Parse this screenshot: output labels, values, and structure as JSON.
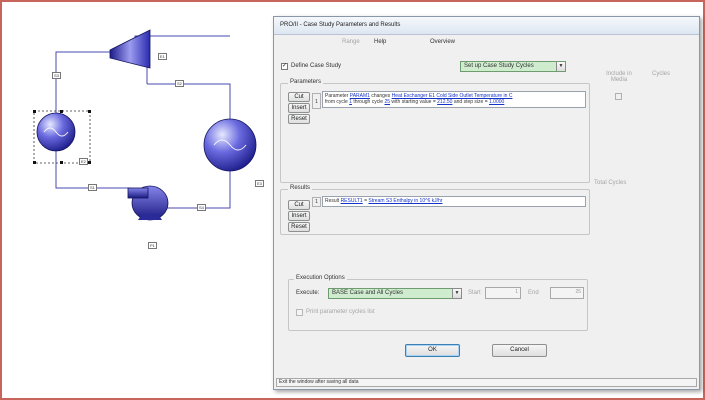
{
  "flowsheet": {
    "stream_labels": [
      "S3",
      "S2",
      "S1",
      "S4",
      "S5"
    ],
    "unit_labels": [
      "E1",
      "E2",
      "P1",
      "E3"
    ]
  },
  "dialog": {
    "title": "PRO/II - Case Study Parameters and Results",
    "menu": {
      "range": "Range",
      "help": "Help",
      "overview": "Overview"
    },
    "define_case_study": "Define Case Study",
    "setup_cycles_select": "Set up Case Study Cycles",
    "parameters_title": "Parameters",
    "include_in_media": "Include in Media",
    "cycles_col": "Cycles",
    "total_cycles": "Total Cycles",
    "buttons": {
      "cut": "Cut",
      "insert": "Insert",
      "reset": "Reset"
    },
    "parameter_row": {
      "index": "1",
      "text_prefix": "Parameter ",
      "param_name": "PARAM1",
      "text_changes": " changes ",
      "param_target": "Heat Exchanger E1 Cold Side Outlet Temperature in C",
      "text_from_cycle": "from cycle ",
      "from_cycle": "1",
      "text_through": " through cycle ",
      "through_cycle": "25",
      "text_start": " with starting value = ",
      "start_value": "212.50",
      "text_step": " and step size = ",
      "step_size": "1.0000"
    },
    "results_title": "Results",
    "result_row": {
      "index": "1",
      "text_prefix": "Result ",
      "result_name": "RESULT1",
      "text_eq": " = ",
      "result_target": "Stream S3 Enthalpy in 10^6 kJ/hr"
    },
    "execution": {
      "title": "Execution Options",
      "execute_label": "Execute:",
      "execute_value": "BASE Case and All Cycles",
      "start_label": "Start",
      "start_value": "1",
      "end_label": "End",
      "end_value": "25",
      "print_cycles": "Print parameter cycles list"
    },
    "ok": "OK",
    "cancel": "Cancel",
    "status": "Exit the window after saving all data"
  },
  "colors": {
    "frame": "#c8655a",
    "equipment_blue": "#2a2ab8",
    "link": "#1433c8"
  }
}
